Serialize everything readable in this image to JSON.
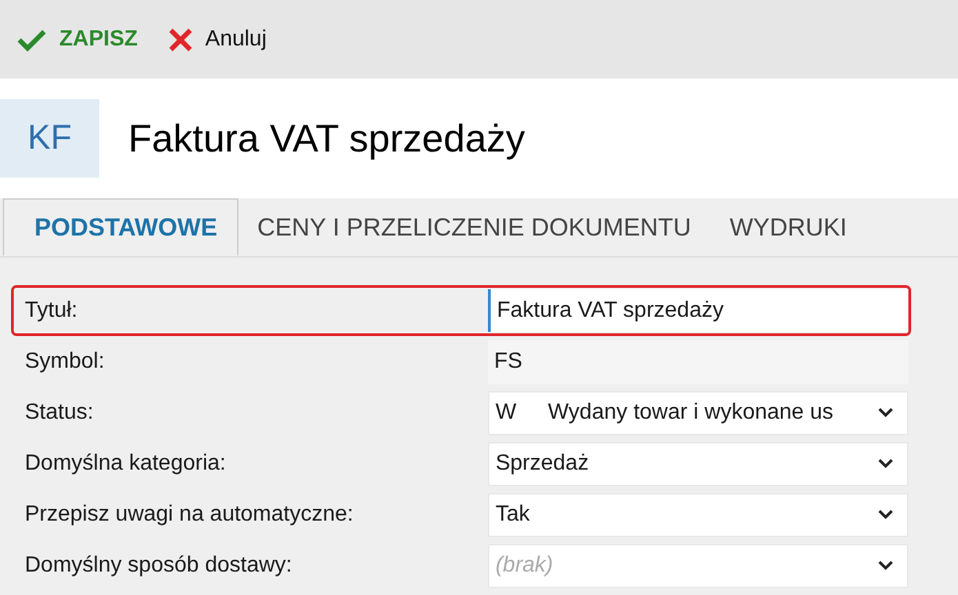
{
  "toolbar": [
    {
      "kind": "save",
      "label": "ZAPISZ"
    },
    {
      "kind": "cancel",
      "label": "Anuluj"
    }
  ],
  "header": {
    "badge": "KF",
    "title": "Faktura VAT sprzedaży"
  },
  "tabs": [
    {
      "label": "PODSTAWOWE",
      "selected": true
    },
    {
      "label": "CENY I PRZELICZENIE DOKUMENTU",
      "selected": false
    },
    {
      "label": "WYDRUKI",
      "selected": false
    }
  ],
  "fields": [
    {
      "label": "Tytuł:",
      "kind": "input",
      "value": "Faktura VAT sprzedaży",
      "highlighted": true
    },
    {
      "label": "Symbol:",
      "kind": "readonly",
      "value": "FS",
      "highlighted": false
    },
    {
      "label": "Status:",
      "kind": "select",
      "code": "W",
      "value": "Wydany towar i wykonane us",
      "highlighted": false
    },
    {
      "label": "Domyślna kategoria:",
      "kind": "select",
      "value": "Sprzedaż",
      "highlighted": false
    },
    {
      "label": "Przepisz uwagi na automatyczne:",
      "kind": "select",
      "value": "Tak",
      "highlighted": false
    },
    {
      "label": "Domyślny sposób dostawy:",
      "kind": "select",
      "placeholder": "(brak)",
      "highlighted": false
    }
  ]
}
